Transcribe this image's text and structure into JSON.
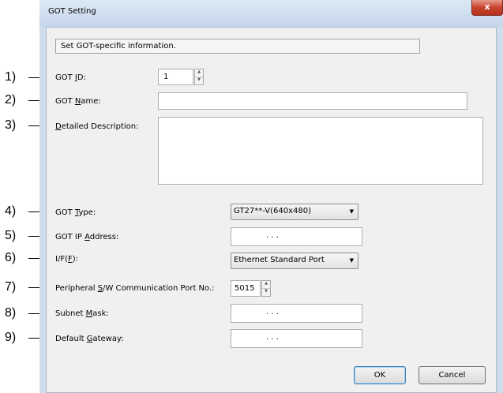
{
  "dialog": {
    "title": "GOT Setting",
    "close_label": "x",
    "info_text": "Set GOT-specific information."
  },
  "annotations": [
    "1)",
    "2)",
    "3)",
    "4)",
    "5)",
    "6)",
    "7)",
    "8)",
    "9)"
  ],
  "fields": {
    "got_id": {
      "label_pre": "GOT ",
      "label_key": "I",
      "label_post": "D:",
      "value": "1"
    },
    "got_name": {
      "label_pre": "GOT ",
      "label_key": "N",
      "label_post": "ame:",
      "value": ""
    },
    "description": {
      "label_pre": "",
      "label_key": "D",
      "label_post": "etailed Description:",
      "value": ""
    },
    "got_type": {
      "label_pre": "GOT ",
      "label_key": "T",
      "label_post": "ype:",
      "value": "GT27**-V(640x480)"
    },
    "got_ip": {
      "label_pre": "GOT IP ",
      "label_key": "A",
      "label_post": "ddress:",
      "dots": ".   .   ."
    },
    "interface": {
      "label_pre": "I/F(",
      "label_key": "F",
      "label_post": "):",
      "value": "Ethernet Standard Port"
    },
    "peripheral_port": {
      "label_pre": "Peripheral ",
      "label_key": "S",
      "label_post": "/W Communication Port No.:",
      "value": "5015"
    },
    "subnet_mask": {
      "label_pre": "Subnet ",
      "label_key": "M",
      "label_post": "ask:",
      "dots": ".   .   ."
    },
    "default_gateway": {
      "label_pre": "Default ",
      "label_key": "G",
      "label_post": "ateway:",
      "dots": ".   .   ."
    }
  },
  "buttons": {
    "ok": "OK",
    "cancel": "Cancel"
  },
  "icons": {
    "spin_up": "up-arrow-icon",
    "spin_down": "down-arrow-icon",
    "dropdown": "chevron-down-icon",
    "close": "close-icon"
  },
  "colors": {
    "titlebar": "#c5d6ea",
    "close_button": "#c7442f",
    "client_bg": "#f0f0f0"
  }
}
